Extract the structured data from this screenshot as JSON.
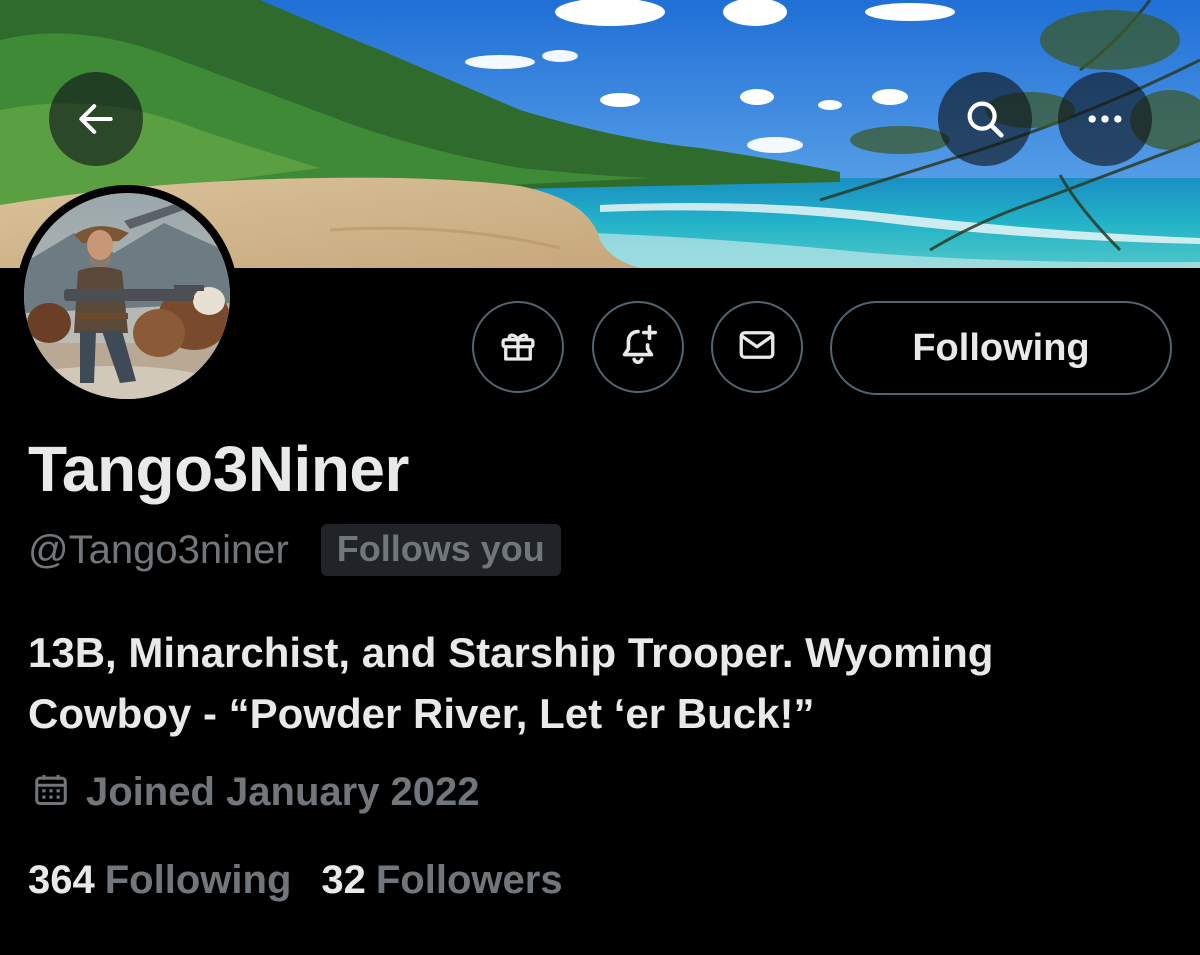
{
  "header": {
    "back_icon": "arrow-left-icon",
    "search_icon": "search-icon",
    "more_icon": "more-horizontal-icon"
  },
  "actions": {
    "gift_icon": "gift-icon",
    "notify_icon": "bell-plus-icon",
    "dm_icon": "envelope-icon",
    "following_label": "Following"
  },
  "profile": {
    "display_name": "Tango3Niner",
    "handle": "@Tango3niner",
    "follows_you_badge": "Follows you",
    "bio_line1": "13B, Minarchist, and Starship Trooper. Wyoming",
    "bio_line2": "Cowboy - “Powder River, Let ‘er Buck!”",
    "joined_icon": "calendar-icon",
    "joined": "Joined January 2022"
  },
  "stats": {
    "following_count": "364",
    "following_label": "Following",
    "followers_count": "32",
    "followers_label": "Followers"
  },
  "colors": {
    "background": "#000000",
    "primary_text": "#e7e9ea",
    "secondary_text": "#71767b",
    "border": "#536471",
    "badge_bg": "#202327"
  }
}
